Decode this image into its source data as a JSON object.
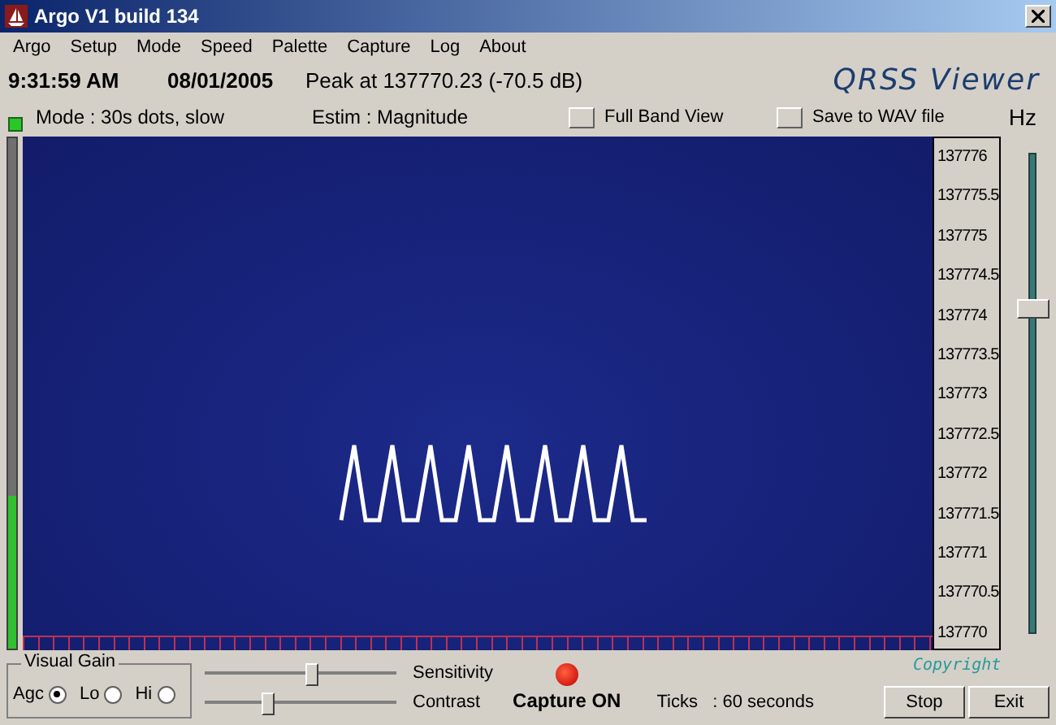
{
  "window": {
    "title": "Argo V1 build 134"
  },
  "menu": [
    "Argo",
    "Setup",
    "Mode",
    "Speed",
    "Palette",
    "Capture",
    "Log",
    "About"
  ],
  "status": {
    "time": "9:31:59 AM",
    "date": "08/01/2005",
    "peak": "Peak at 137770.23 (-70.5 dB)",
    "logo": "QRSS Viewer"
  },
  "mode_row": {
    "mode": "Mode : 30s dots, slow",
    "estim": "Estim : Magnitude",
    "unit": "Hz",
    "toggles": [
      {
        "label": "Full Band View",
        "checked": false
      },
      {
        "label": "Save to WAV file",
        "checked": false
      }
    ]
  },
  "signal_meter": {
    "level": 0.3
  },
  "frequency_scale": [
    "137776",
    "137775.5",
    "137775",
    "137774.5",
    "137774",
    "137773.5",
    "137773",
    "137772.5",
    "137772",
    "137771.5",
    "137771",
    "137770.5",
    "137770"
  ],
  "scroll_slider": {
    "level": 0.68
  },
  "visual_gain": {
    "title": "Visual Gain",
    "options": [
      {
        "label": "Agc",
        "selected": true
      },
      {
        "label": "Lo",
        "selected": false
      },
      {
        "label": "Hi",
        "selected": false
      }
    ]
  },
  "sliders": [
    {
      "label": "Sensitivity",
      "level": 0.55
    },
    {
      "label": "Contrast",
      "level": 0.32
    }
  ],
  "capture": {
    "label": "Capture ON",
    "on": true
  },
  "ticks": "Ticks   : 60 seconds",
  "buttons": [
    "Stop",
    "Exit"
  ],
  "copyright": "Copyright"
}
